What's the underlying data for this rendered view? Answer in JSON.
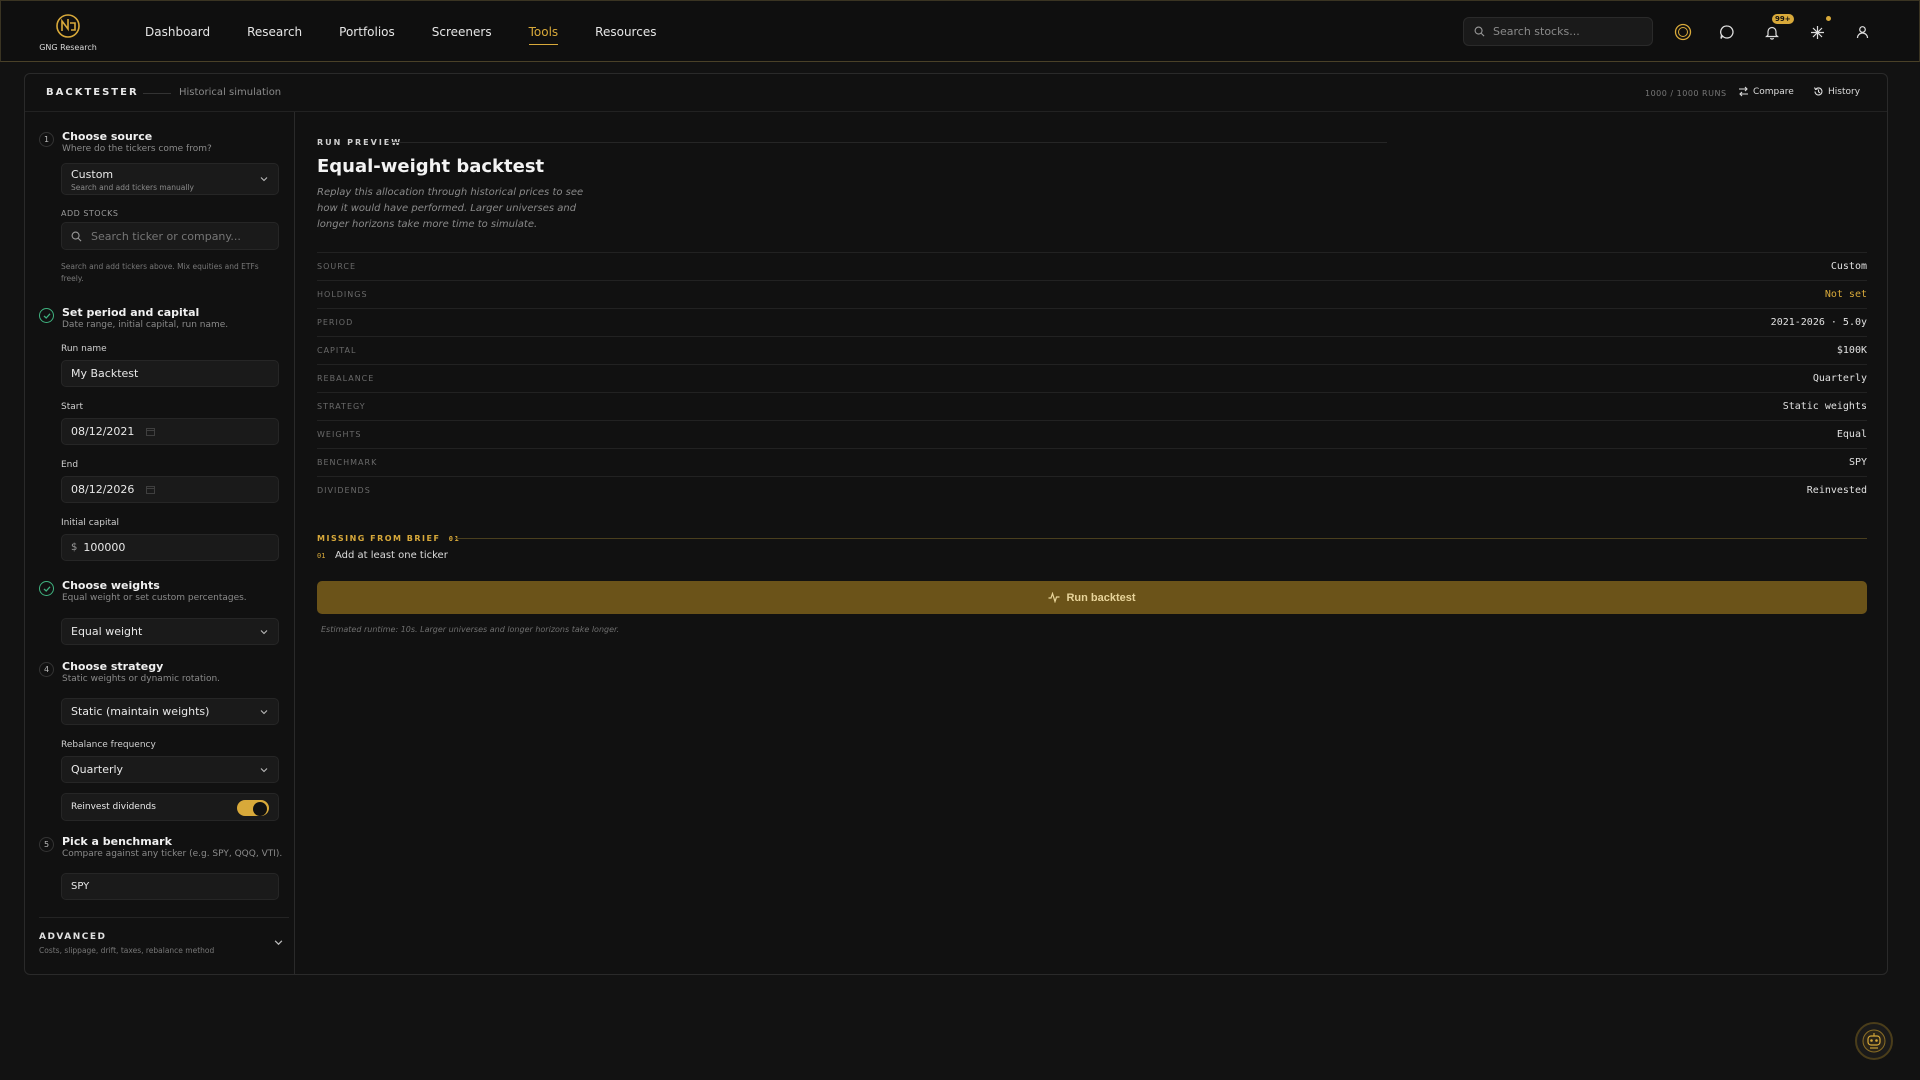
{
  "brand": {
    "name": "GNG Research"
  },
  "nav": {
    "links": [
      "Dashboard",
      "Research",
      "Portfolios",
      "Screeners",
      "Tools",
      "Resources"
    ],
    "active": "Tools",
    "search_placeholder": "Search stocks...",
    "notification_badge": "99+"
  },
  "header": {
    "title": "BACKTESTER",
    "subtitle": "Historical simulation",
    "runs": "1000 / 1000 RUNS",
    "compare_label": "Compare",
    "history_label": "History"
  },
  "steps": {
    "source": {
      "num": "1",
      "title": "Choose source",
      "sub": "Where do the tickers come from?",
      "value": "Custom",
      "value_sub": "Search and add tickers manually",
      "add_label": "ADD STOCKS",
      "search_placeholder": "Search ticker or company...",
      "hint": "Search and add tickers above. Mix equities and ETFs freely."
    },
    "period": {
      "title": "Set period and capital",
      "sub": "Date range, initial capital, run name.",
      "run_name_label": "Run name",
      "run_name": "My Backtest",
      "start_label": "Start",
      "start": "08/12/2021",
      "end_label": "End",
      "end": "08/12/2026",
      "capital_label": "Initial capital",
      "currency": "$",
      "capital": "100000"
    },
    "weights": {
      "title": "Choose weights",
      "sub": "Equal weight or set custom percentages.",
      "value": "Equal weight"
    },
    "strategy": {
      "num": "4",
      "title": "Choose strategy",
      "sub": "Static weights or dynamic rotation.",
      "value": "Static (maintain weights)",
      "rebalance_label": "Rebalance frequency",
      "rebalance": "Quarterly",
      "reinvest_label": "Reinvest dividends",
      "reinvest_on": true
    },
    "benchmark": {
      "num": "5",
      "title": "Pick a benchmark",
      "sub": "Compare against any ticker (e.g. SPY, QQQ, VTI).",
      "value": "SPY"
    },
    "advanced": {
      "title": "ADVANCED",
      "sub": "Costs, slippage, drift, taxes, rebalance method"
    }
  },
  "preview": {
    "label": "RUN PREVIEW",
    "title": "Equal-weight backtest",
    "desc": "Replay this allocation through historical prices to see how it would have performed. Larger universes and longer horizons take more time to simulate.",
    "rows": [
      {
        "k": "SOURCE",
        "v": "Custom"
      },
      {
        "k": "HOLDINGS",
        "v": "Not set"
      },
      {
        "k": "PERIOD",
        "v": "2021-2026 · 5.0y"
      },
      {
        "k": "CAPITAL",
        "v": "$100K"
      },
      {
        "k": "REBALANCE",
        "v": "Quarterly"
      },
      {
        "k": "STRATEGY",
        "v": "Static weights"
      },
      {
        "k": "WEIGHTS",
        "v": "Equal"
      },
      {
        "k": "BENCHMARK",
        "v": "SPY"
      },
      {
        "k": "DIVIDENDS",
        "v": "Reinvested"
      }
    ],
    "missing_label": "MISSING FROM BRIEF",
    "missing_count": "01",
    "missing_items": [
      {
        "num": "01",
        "text": "Add at least one ticker"
      }
    ],
    "run_label": "Run backtest",
    "run_note": "Estimated runtime: 10s. Larger universes and longer horizons take longer."
  },
  "colors": {
    "accent": "#d8a93a",
    "success": "#3fb27f",
    "background": "#121212"
  }
}
